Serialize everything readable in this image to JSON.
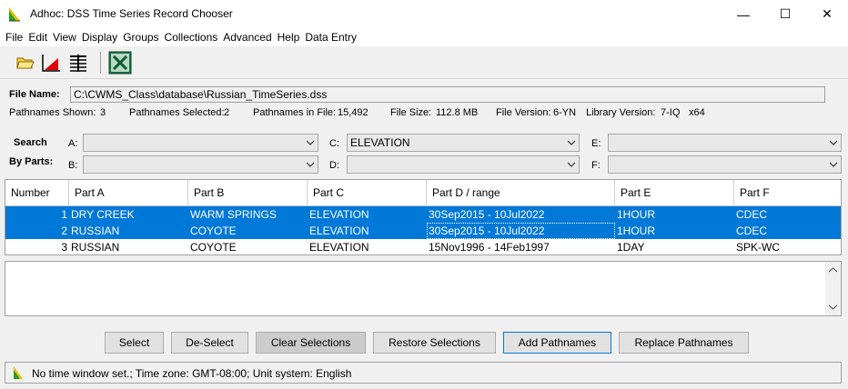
{
  "window": {
    "title": "Adhoc: DSS Time Series Record Chooser",
    "min_glyph": "—",
    "max_glyph": "☐",
    "close_glyph": "✕"
  },
  "menu": [
    "File",
    "Edit",
    "View",
    "Display",
    "Groups",
    "Collections",
    "Advanced",
    "Help",
    "Data Entry"
  ],
  "toolbar": {
    "icons": [
      "open-folder-icon",
      "plot-icon",
      "tabulate-icon",
      "excel-icon"
    ]
  },
  "file": {
    "label": "File Name:",
    "value": "C:\\CWMS_Class\\database\\Russian_TimeSeries.dss"
  },
  "stats": {
    "shown_label": "Pathnames Shown:",
    "shown": "3",
    "selected_label": "Pathnames Selected:",
    "selected": "2",
    "in_file_label": "Pathnames in File:",
    "in_file": "15,492",
    "size_label": "File Size:",
    "size": "112.8  MB",
    "version_label": "File Version:",
    "version": "6-YN",
    "lib_label": "Library Version:",
    "lib": "7-IQ",
    "arch": "x64"
  },
  "search": {
    "label1": "Search",
    "label2": "By Parts:",
    "a_label": "A:",
    "a_value": "",
    "b_label": "B:",
    "b_value": "",
    "c_label": "C:",
    "c_value": "ELEVATION",
    "d_label": "D:",
    "d_value": "",
    "e_label": "E:",
    "e_value": "",
    "f_label": "F:",
    "f_value": ""
  },
  "table": {
    "columns": [
      "Number",
      "Part A",
      "Part B",
      "Part C",
      "Part D / range",
      "Part E",
      "Part F"
    ],
    "rows": [
      [
        "1",
        "DRY CREEK",
        "WARM SPRINGS",
        "ELEVATION",
        "30Sep2015 - 10Jul2022",
        "1HOUR",
        "CDEC"
      ],
      [
        "2",
        "RUSSIAN",
        "COYOTE",
        "ELEVATION",
        "30Sep2015 - 10Jul2022",
        "1HOUR",
        "CDEC"
      ],
      [
        "3",
        "RUSSIAN",
        "COYOTE",
        "ELEVATION",
        "15Nov1996 - 14Feb1997",
        "1DAY",
        "SPK-WC"
      ]
    ],
    "selected_rows": [
      0,
      1
    ]
  },
  "buttons": {
    "select": "Select",
    "deselect": "De-Select",
    "clear": "Clear Selections",
    "restore": "Restore Selections",
    "add": "Add Pathnames",
    "replace": "Replace Pathnames"
  },
  "status": {
    "text": "No time window set.;  Time zone: GMT-08:00;  Unit system: English"
  },
  "colors": {
    "selection": "#0078d7",
    "icon_green": "#2a9d2a",
    "icon_yellow": "#e8c000"
  }
}
